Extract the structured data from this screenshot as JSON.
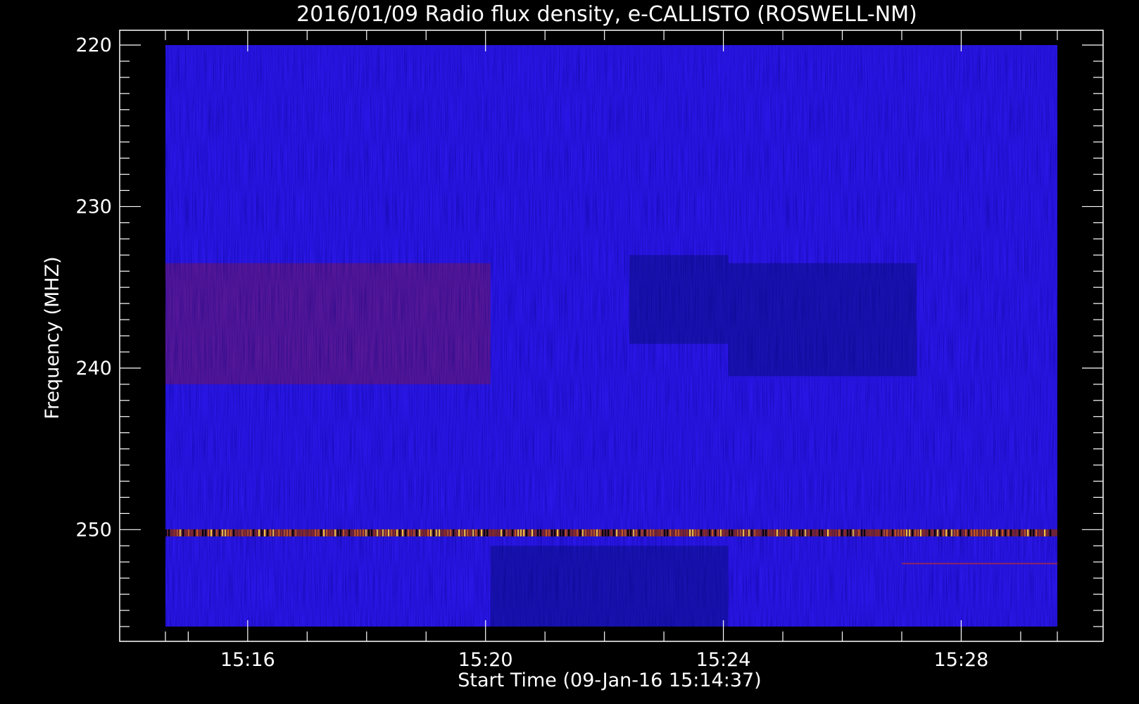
{
  "chart_data": {
    "type": "heatmap",
    "title": "2016/01/09  Radio flux density, e-CALLISTO (ROSWELL-NM)",
    "xlabel": "Start Time (09-Jan-16 15:14:37)",
    "ylabel": "Frequency (MHZ)",
    "x_range": [
      "15:14:37",
      "15:29:37"
    ],
    "y_range_mhz": [
      220,
      256
    ],
    "y_axis_inverted": true,
    "x_ticks": [
      "15:16",
      "15:20",
      "15:24",
      "15:28"
    ],
    "y_ticks": [
      220,
      230,
      240,
      250
    ],
    "grid": false,
    "colors": {
      "background": "#000000",
      "base": "#2a16e6",
      "quiet": "#10108a",
      "enhanced": "#7a1a5a",
      "burst": "#ffcc44"
    },
    "features": [
      {
        "type": "band",
        "freq_mhz": [
          233.5,
          241
        ],
        "time": [
          "15:14:37",
          "15:20:05"
        ],
        "level": "enhanced"
      },
      {
        "type": "band",
        "freq_mhz": [
          233,
          238.5
        ],
        "time": [
          "15:22:25",
          "15:24:05"
        ],
        "level": "quiet"
      },
      {
        "type": "band",
        "freq_mhz": [
          233.5,
          240.5
        ],
        "time": [
          "15:24:05",
          "15:27:15"
        ],
        "level": "quiet"
      },
      {
        "type": "band",
        "freq_mhz": [
          251,
          256
        ],
        "time": [
          "15:20:05",
          "15:24:05"
        ],
        "level": "quiet"
      },
      {
        "type": "line",
        "freq_mhz": 250.2,
        "time": [
          "15:14:37",
          "15:29:37"
        ],
        "level": "burst"
      },
      {
        "type": "line",
        "freq_mhz": 252.1,
        "time": [
          "15:27:00",
          "15:29:37"
        ],
        "level": "enhanced"
      }
    ]
  }
}
